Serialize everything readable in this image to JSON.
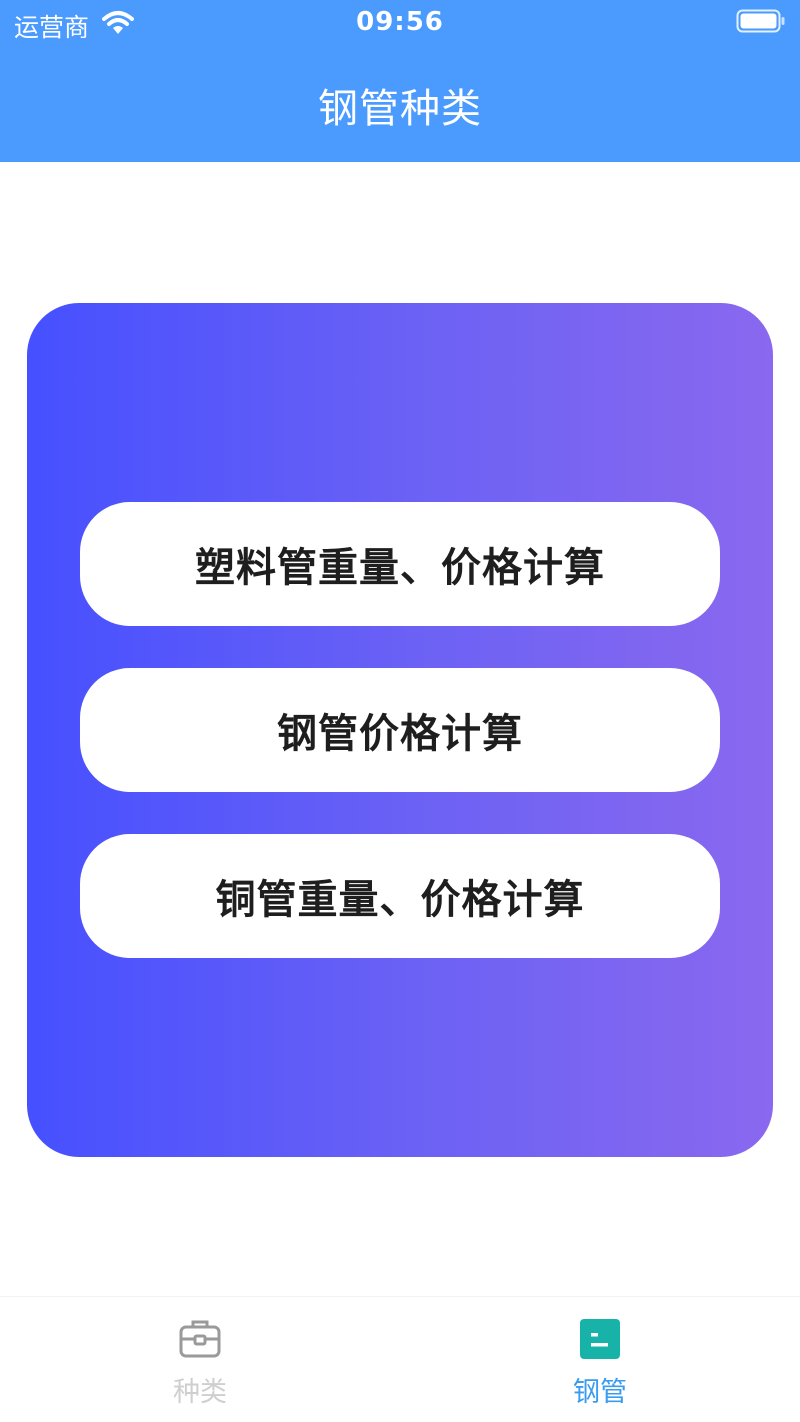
{
  "status_bar": {
    "carrier": "运营商",
    "time": "09:56",
    "icons": [
      "wifi-icon",
      "battery-icon"
    ]
  },
  "header": {
    "title": "钢管种类",
    "background": "#4a9bfd"
  },
  "card": {
    "gradient_start": "#4650ff",
    "gradient_end": "#8a68ef",
    "buttons": [
      {
        "label": "塑料管重量、价格计算"
      },
      {
        "label": "钢管价格计算"
      },
      {
        "label": "铜管重量、价格计算"
      }
    ]
  },
  "tab_bar": {
    "tabs": [
      {
        "label": "种类",
        "icon": "toolbox-icon",
        "selected": false
      },
      {
        "label": "钢管",
        "icon": "document-icon",
        "selected": true
      }
    ],
    "active_color": "#3a9cf0",
    "active_icon_color": "#17b3a8",
    "inactive_color": "#cfcfcf"
  }
}
